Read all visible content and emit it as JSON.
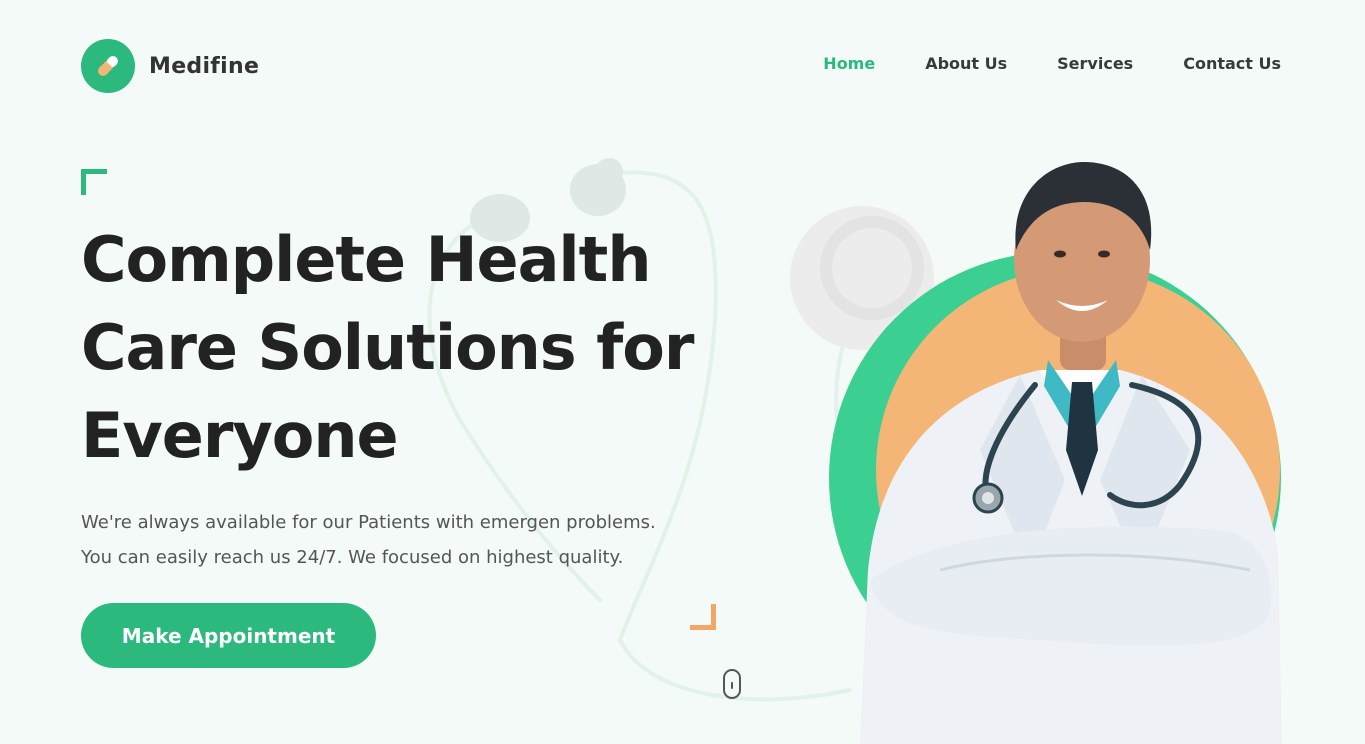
{
  "brand": {
    "name": "Medifine",
    "icon": "pill-icon",
    "accent": "#2bb97e",
    "orange": "#f4b677"
  },
  "nav": {
    "items": [
      {
        "label": "Home",
        "active": true
      },
      {
        "label": "About Us",
        "active": false
      },
      {
        "label": "Services",
        "active": false
      },
      {
        "label": "Contact Us",
        "active": false
      }
    ]
  },
  "hero": {
    "title_lines": [
      "Complete Health",
      "Care Solutions for",
      "Everyone"
    ],
    "description_lines": [
      "We're always available for our Patients with emergen problems.",
      "You can easily reach us 24/7. We focused on highest quality."
    ],
    "cta_label": "Make Appointment"
  }
}
